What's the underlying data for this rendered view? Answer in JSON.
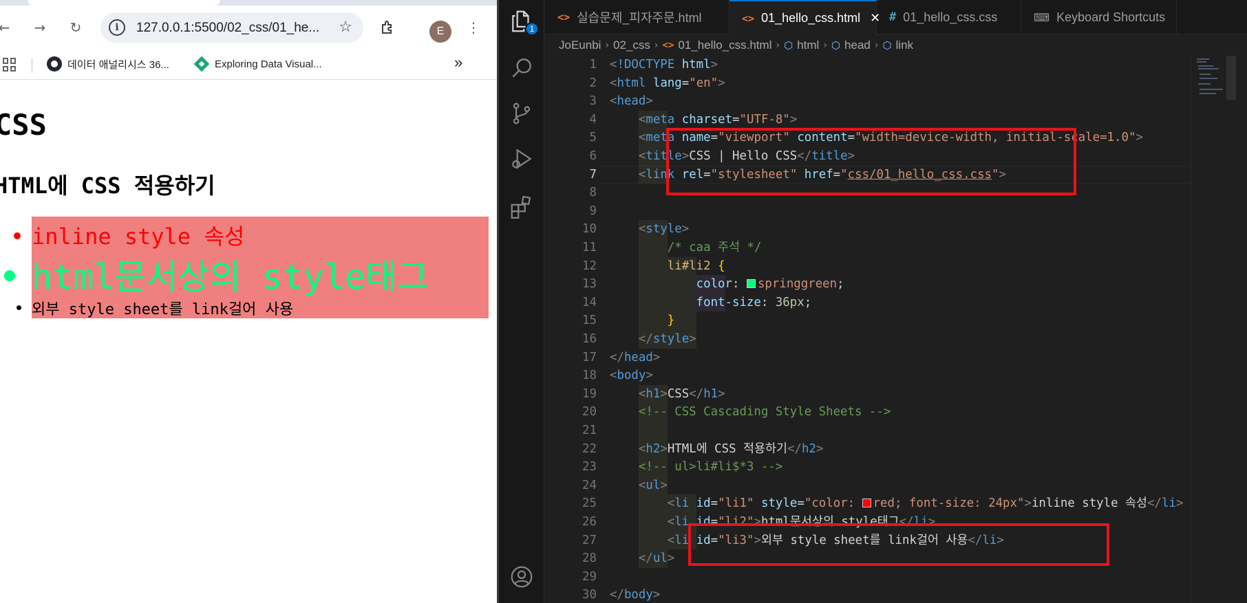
{
  "browser": {
    "omnibox": {
      "url": "127.0.0.1:5500/02_css/01_he..."
    },
    "avatar_letter": "E",
    "bookmarks": [
      {
        "label": "데이터 애널리시스 36..."
      },
      {
        "label": "Exploring Data Visual..."
      }
    ],
    "overflow_label": "»",
    "page": {
      "h1": "CSS",
      "h2": "HTML에 CSS 적용하기",
      "items": [
        "inline style 속성",
        "html문서상의 style태그",
        "외부 style sheet를 link걸어 사용"
      ],
      "colors": {
        "li1": "#ff0000",
        "li2": "#00ff7f",
        "list_bg": "#f08080"
      }
    }
  },
  "vscode": {
    "explorer_badge": "1",
    "tabs": [
      {
        "label": "실습문제_피자주문.html",
        "type": "html"
      },
      {
        "label": "01_hello_css.html",
        "type": "html",
        "active": true
      },
      {
        "label": "01_hello_css.css",
        "type": "css",
        "dirty": true
      },
      {
        "label": "Keyboard Shortcuts",
        "type": "keyboard"
      }
    ],
    "breadcrumb": [
      "JoEunbi",
      "02_css",
      "01_hello_css.html",
      "html",
      "head",
      "link"
    ],
    "current_line": 7,
    "lines": [
      "1",
      "2",
      "3",
      "4",
      "5",
      "6",
      "7",
      "8",
      "9",
      "10",
      "11",
      "12",
      "13",
      "14",
      "15",
      "16",
      "17",
      "18",
      "19",
      "20",
      "21",
      "22",
      "23",
      "24",
      "25",
      "26",
      "27",
      "28",
      "29",
      "30"
    ],
    "code": {
      "l1_doctype": "!DOCTYPE",
      "l1_html": "html",
      "l2_tag": "html",
      "l2_attr": "lang",
      "l2_val": "\"en\"",
      "l3_tag": "head",
      "l4_tag": "meta",
      "l4_attr": "charset",
      "l4_val": "\"UTF-8\"",
      "l5_tag": "meta",
      "l5_attr1": "name",
      "l5_val1": "\"viewport\"",
      "l5_attr2": "content",
      "l5_val2": "\"width=device-width, initial-scale=1.0\"",
      "l6_tag": "title",
      "l6_text": "CSS | Hello CSS",
      "l7_tag": "link",
      "l7_attr1": "rel",
      "l7_val1": "\"stylesheet\"",
      "l7_attr2": "href",
      "l7_q": "\"",
      "l7_href": "css/01_hello_css.css",
      "l10_tag": "style",
      "l11_comment": "/* caa 주석 */",
      "l12_selector": "li#li2",
      "l12_brace": "{",
      "l13_prop": "color",
      "l13_val": "springgreen",
      "l13_color": "#00ff7f",
      "l14_prop": "font-size",
      "l14_val": "36px",
      "l15_brace": "}",
      "l16_tag": "style",
      "l17_tag": "head",
      "l18_tag": "body",
      "l19_tag": "h1",
      "l19_text": "CSS",
      "l20_comment": "<!-- CSS Cascading Style Sheets -->",
      "l22_tag": "h2",
      "l22_text": "HTML에 CSS 적용하기",
      "l23_comment": "<!-- ul>li#li$*3 -->",
      "l24_tag": "ul",
      "l25_tag": "li",
      "l25_attr1": "id",
      "l25_val1": "\"li1\"",
      "l25_attr2": "style",
      "l25_val2a": "\"color: ",
      "l25_val2b": "red; font-size: 24px\"",
      "l25_color": "#ff0000",
      "l25_text": "inline style 속성",
      "l26_tag": "li",
      "l26_attr": "id",
      "l26_val": "\"li2\"",
      "l26_text": "html문서상의 style태그",
      "l27_tag": "li",
      "l27_attr": "id",
      "l27_val": "\"li3\"",
      "l27_text": "외부 style sheet를 link걸어 사용",
      "l28_tag": "ul",
      "l30_tag": "body"
    },
    "highlight_color": "#e8131b"
  }
}
